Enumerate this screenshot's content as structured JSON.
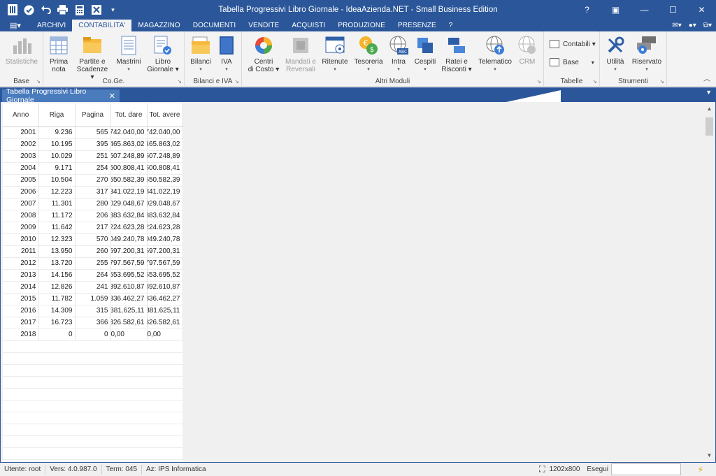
{
  "window": {
    "title": "Tabella Progressivi Libro Giornale - IdeaAzienda.NET - Small Business Edition",
    "controls": {
      "help": "?",
      "restore_tile": "▣",
      "minimize": "—",
      "maximize": "☐",
      "close": "✕"
    }
  },
  "menu": {
    "app_button": "▤▾",
    "tabs": [
      "ARCHIVI",
      "CONTABILITA'",
      "MAGAZZINO",
      "DOCUMENTI",
      "VENDITE",
      "ACQUISTI",
      "PRODUZIONE",
      "PRESENZE",
      "?"
    ],
    "active_tab": "CONTABILITA'",
    "right_icons": [
      "✉▾",
      "●▾",
      "⧉▾"
    ]
  },
  "ribbon": {
    "groups": {
      "base": "Base",
      "coge": "Co.Ge.",
      "bilanci_iva": "Bilanci e IVA",
      "altri_moduli": "Altri Moduli",
      "tabelle": "Tabelle",
      "strumenti": "Strumenti"
    },
    "buttons": {
      "statistiche": "Statistiche",
      "prima_nota_1": "Prima",
      "prima_nota_2": "nota",
      "partite_1": "Partite e",
      "partite_2": "Scadenze ▾",
      "mastrini": "Mastrini",
      "libro_1": "Libro",
      "libro_2": "Giornale ▾",
      "bilanci": "Bilanci",
      "iva": "IVA",
      "centri_1": "Centri",
      "centri_2": "di Costo ▾",
      "mandati_1": "Mandati e",
      "mandati_2": "Reversali",
      "ritenute": "Ritenute",
      "tesoreria": "Tesoreria",
      "intra": "Intra",
      "cespiti": "Cespiti",
      "ratei_1": "Ratei e",
      "ratei_2": "Risconti ▾",
      "telematico": "Telematico",
      "crm": "CRM",
      "contabili": "Contabili ▾",
      "base_small": "Base",
      "utilita": "Utilità",
      "riservato": "Riservato"
    },
    "intra_badge": "ABC",
    "collapse_icon": "︿"
  },
  "document": {
    "tab_title": "Tabella Progressivi Libro Giornale",
    "close": "✕"
  },
  "grid": {
    "columns": [
      "Anno",
      "Riga",
      "Pagina",
      "Tot. dare",
      "Tot. avere"
    ],
    "rows": [
      [
        "2001",
        "9.236",
        "565",
        "742.040,00",
        "742.040,00"
      ],
      [
        "2002",
        "10.195",
        "395",
        "465.863,02",
        "465.863,02"
      ],
      [
        "2003",
        "10.029",
        "251",
        "507.248,89",
        "507.248,89"
      ],
      [
        "2004",
        "9.171",
        "254",
        "500.808,41",
        "500.808,41"
      ],
      [
        "2005",
        "10.504",
        "270",
        "550.582,39",
        "550.582,39"
      ],
      [
        "2006",
        "12.223",
        "317",
        "341.022,19",
        "341.022,19"
      ],
      [
        "2007",
        "11.301",
        "280",
        "029.048,67",
        "029.048,67"
      ],
      [
        "2008",
        "11.172",
        "206",
        "383.632,84",
        "383.632,84"
      ],
      [
        "2009",
        "11.642",
        "217",
        "224.623,28",
        "224.623,28"
      ],
      [
        "2010",
        "12.323",
        "570",
        "049.240,78",
        "049.240,78"
      ],
      [
        "2011",
        "13.950",
        "260",
        "597.200,31",
        "597.200,31"
      ],
      [
        "2012",
        "13.720",
        "255",
        "797.567,59",
        "797.567,59"
      ],
      [
        "2013",
        "14.156",
        "264",
        "553.695,52",
        "553.695,52"
      ],
      [
        "2014",
        "12.826",
        "241",
        "392.610,87",
        "392.610,87"
      ],
      [
        "2015",
        "11.782",
        "1.059",
        "336.462,27",
        "336.462,27"
      ],
      [
        "2016",
        "14.309",
        "315",
        "381.625,11",
        "381.625,11"
      ],
      [
        "2017",
        "16.723",
        "366",
        "326.582,61",
        "326.582,61"
      ],
      [
        "2018",
        "0",
        "0",
        "0,00",
        "0,00"
      ]
    ]
  },
  "status": {
    "user": "Utente: root",
    "version": "Vers: 4.0.987.0",
    "term": "Term: 045",
    "company": "Az: IPS Informatica",
    "resolution": "1202x800",
    "exec_label": "Esegui",
    "bolt": "⚡"
  },
  "colors": {
    "accent": "#2b579a",
    "ribbon_bg": "#f3f3f3",
    "grid_bg": "#ffffff"
  }
}
